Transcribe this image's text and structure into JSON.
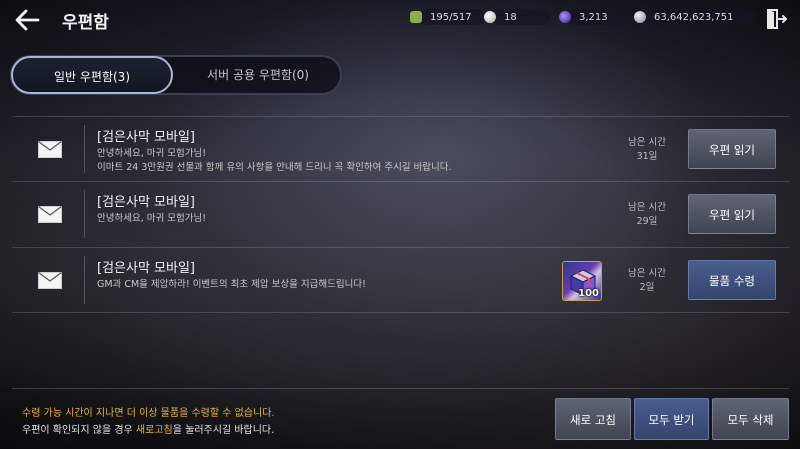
{
  "header": {
    "title": "우편함",
    "back_icon": "arrow-left-icon",
    "exit_icon": "exit-door-icon"
  },
  "currencies": [
    {
      "icon": "inventory-weight-icon",
      "value": "195/517",
      "color": "#8fae4a"
    },
    {
      "icon": "pearl-icon",
      "value": "18",
      "color": "#d8d8d8"
    },
    {
      "icon": "black-energy-icon",
      "value": "3,213",
      "color": "#6a4ad0"
    },
    {
      "icon": "silver-coin-icon",
      "value": "63,642,623,751",
      "color": "#b9c3d4"
    }
  ],
  "tabs": [
    {
      "label": "일반 우편함(3)",
      "active": true
    },
    {
      "label": "서버 공용 우편함(0)",
      "active": false
    }
  ],
  "mails": [
    {
      "sender": "[검은사막 모바일]",
      "lines": [
        "안녕하세요, 마귀 모험가님!",
        "이마트 24 3만원권 선물과 함께 유의 사항을 안내해 드리니 꼭 확인하여 주시길 바랍니다."
      ],
      "remain_label": "남은 시간",
      "remain_value": "31일",
      "button": "우편 읽기",
      "button_type": "read"
    },
    {
      "sender": "[검은사막 모바일]",
      "lines": [
        "안녕하세요, 마귀 모험가님!"
      ],
      "remain_label": "남은 시간",
      "remain_value": "29일",
      "button": "우편 읽기",
      "button_type": "read"
    },
    {
      "sender": "[검은사막 모바일]",
      "lines": [
        "GM과 CM을 제압하라! 이벤트의 최초 제압 보상을 지급해드립니다!"
      ],
      "remain_label": "남은 시간",
      "remain_value": "2일",
      "button": "물품 수령",
      "button_type": "claim",
      "attachment": {
        "icon": "reward-box-icon",
        "quantity": "100"
      }
    }
  ],
  "footer": {
    "notice1": "수령 가능 시간이 지나면 더 이상 물품을 수령할 수 없습니다.",
    "notice2_pre": "우편이 확인되지 않을 경우 ",
    "notice2_highlight": "새로고침",
    "notice2_post": "을 눌러주시길 바랍니다.",
    "buttons": {
      "refresh": "새로 고침",
      "receive_all": "모두 받기",
      "delete_all": "모두 삭제"
    }
  },
  "colors": {
    "highlight": "#e8b53c",
    "claim_button": "#3f5080",
    "read_button": "#4f5561"
  }
}
